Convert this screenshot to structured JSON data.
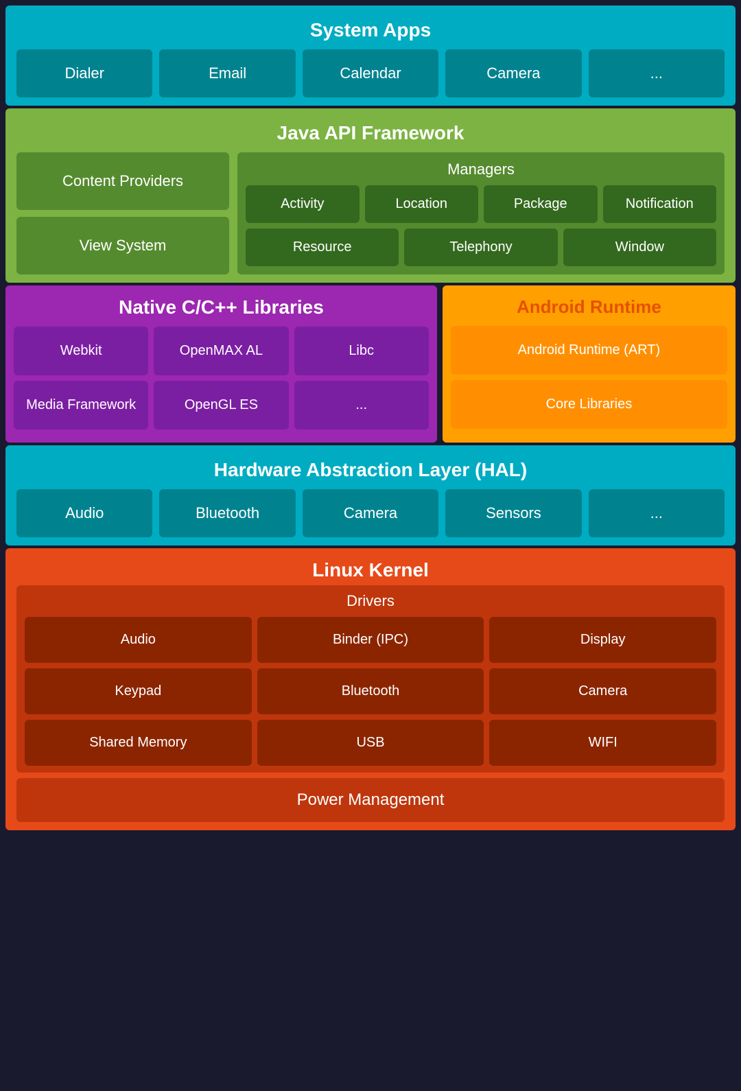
{
  "systemApps": {
    "title": "System Apps",
    "apps": [
      "Dialer",
      "Email",
      "Calendar",
      "Camera",
      "..."
    ]
  },
  "javaApi": {
    "title": "Java API Framework",
    "leftItems": [
      "Content Providers",
      "View System"
    ],
    "managers": {
      "title": "Managers",
      "row1": [
        "Activity",
        "Location",
        "Package",
        "Notification"
      ],
      "row2": [
        "Resource",
        "Telephony",
        "Window"
      ]
    }
  },
  "nativeLibs": {
    "title": "Native C/C++ Libraries",
    "row1": [
      "Webkit",
      "OpenMAX AL",
      "Libc"
    ],
    "row2": [
      "Media Framework",
      "OpenGL ES",
      "..."
    ]
  },
  "androidRuntime": {
    "title": "Android Runtime",
    "cards": [
      "Android Runtime (ART)",
      "Core Libraries"
    ]
  },
  "hal": {
    "title": "Hardware Abstraction Layer (HAL)",
    "items": [
      "Audio",
      "Bluetooth",
      "Camera",
      "Sensors",
      "..."
    ]
  },
  "linuxKernel": {
    "title": "Linux Kernel",
    "drivers": {
      "title": "Drivers",
      "row1": [
        "Audio",
        "Binder (IPC)",
        "Display"
      ],
      "row2": [
        "Keypad",
        "Bluetooth",
        "Camera"
      ],
      "row3": [
        "Shared Memory",
        "USB",
        "WIFI"
      ]
    },
    "powerManagement": "Power Management"
  }
}
